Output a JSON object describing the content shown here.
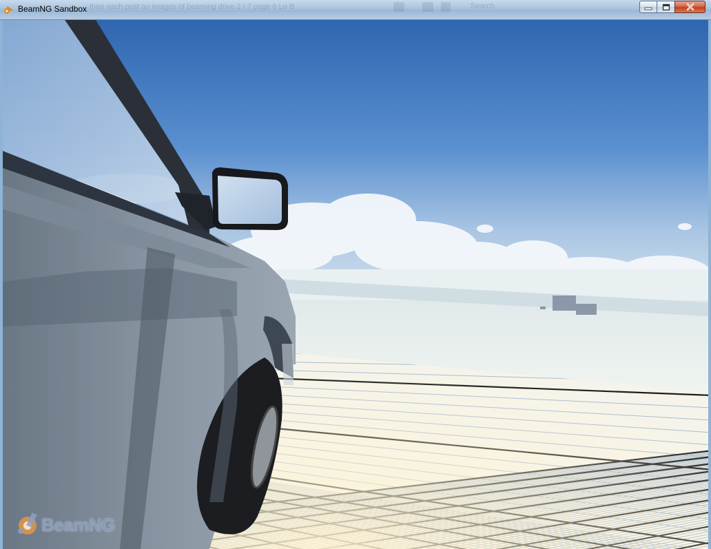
{
  "window": {
    "title": "BeamNG Sandbox",
    "background_ghost_text": "then each post an images of beaming drive 2 / 7 page 6 Lo B",
    "background_ghost_search": "Search"
  },
  "controls": {
    "minimize_icon": "minimize-icon",
    "maximize_icon": "maximize-icon",
    "close_icon": "close-icon"
  },
  "scene": {
    "sky_color": "#3e74b8",
    "horizon_color": "#dbe6ea",
    "ground_color": "#eef3f0",
    "grid_color": "#5b7da8",
    "car_body_color": "#7d8a98"
  },
  "logo": {
    "text": "BeamNG",
    "icon": "beamng-logo-icon"
  }
}
